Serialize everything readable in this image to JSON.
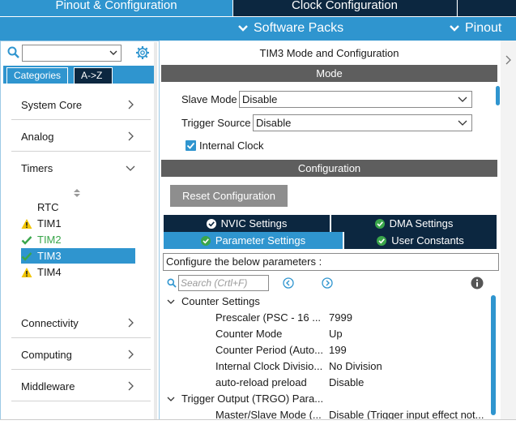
{
  "top_tabs": [
    {
      "label": "Pinout & Configuration"
    },
    {
      "label": "Clock Configuration"
    }
  ],
  "sub_bar": {
    "software_packs": "Software Packs",
    "pinout": "Pinout"
  },
  "left": {
    "search_value": "",
    "categories_btn": "Categories",
    "az_btn": "A->Z",
    "groups": [
      {
        "label": "System Core"
      },
      {
        "label": "Analog"
      },
      {
        "label": "Timers"
      },
      {
        "label": "Connectivity"
      },
      {
        "label": "Computing"
      },
      {
        "label": "Middleware"
      }
    ],
    "timers": [
      {
        "label": "RTC",
        "status": "none"
      },
      {
        "label": "TIM1",
        "status": "warning"
      },
      {
        "label": "TIM2",
        "status": "ok"
      },
      {
        "label": "TIM3",
        "status": "ok-selected"
      },
      {
        "label": "TIM4",
        "status": "warning"
      }
    ]
  },
  "mode": {
    "title": "TIM3 Mode and Configuration",
    "header": "Mode",
    "slave_mode_label": "Slave Mode",
    "slave_mode_value": "Disable",
    "trigger_source_label": "Trigger Source",
    "trigger_source_value": "Disable",
    "internal_clock_label": "Internal Clock",
    "internal_clock_checked": true
  },
  "configuration": {
    "header": "Configuration",
    "reset_button": "Reset Configuration",
    "tabs": [
      {
        "label": "NVIC Settings"
      },
      {
        "label": "DMA Settings"
      },
      {
        "label": "Parameter Settings"
      },
      {
        "label": "User Constants"
      }
    ],
    "configure_label": "Configure the below parameters :",
    "search_placeholder": "Search (Crtl+F)",
    "groups": [
      {
        "label": "Counter Settings",
        "params": [
          {
            "name": "Prescaler (PSC - 16 ...",
            "value": "7999"
          },
          {
            "name": "Counter Mode",
            "value": "Up"
          },
          {
            "name": "Counter Period (Auto...",
            "value": "199"
          },
          {
            "name": "Internal Clock Divisio...",
            "value": "No Division"
          },
          {
            "name": "auto-reload preload",
            "value": "Disable"
          }
        ]
      },
      {
        "label": "Trigger Output (TRGO) Para...",
        "params": [
          {
            "name": "Master/Slave Mode (...",
            "value": "Disable (Trigger input effect not..."
          }
        ]
      }
    ]
  },
  "colors": {
    "accent": "#2f95cf",
    "dark_navy": "#0c2740",
    "header_gray": "#5e5e5e",
    "ok_green": "#3aa64b",
    "warning_yellow": "#f2c500"
  }
}
